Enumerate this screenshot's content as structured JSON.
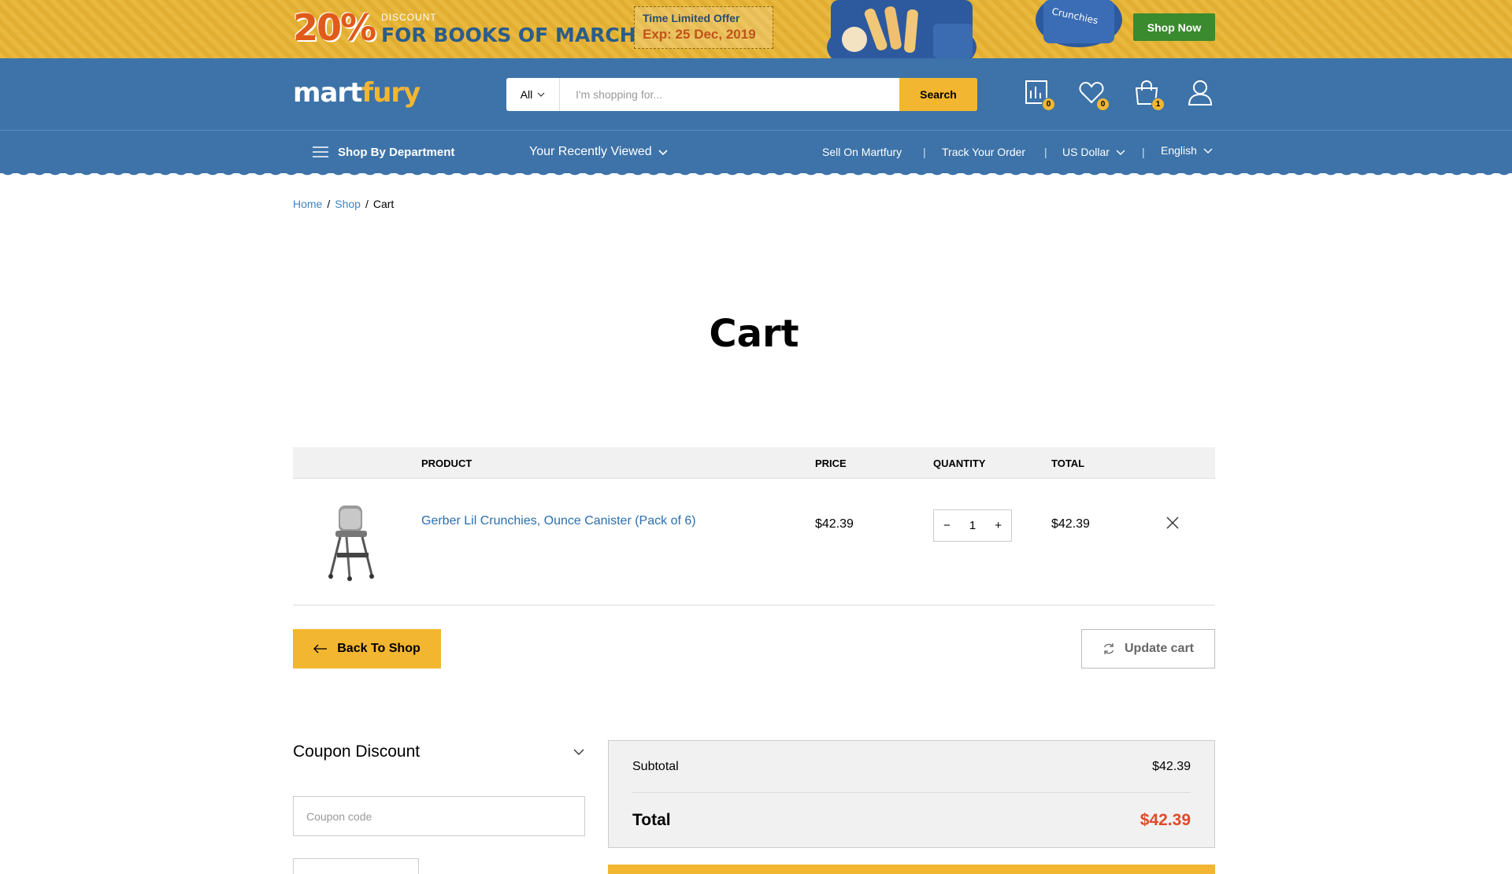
{
  "promo": {
    "percent": "20%",
    "discount_label": "DISCOUNT",
    "headline": "FOR BOOKS OF MARCH",
    "offer_title": "Time Limited Offer",
    "offer_expiry": "Exp: 25 Dec, 2019",
    "shop_now": "Shop Now"
  },
  "header": {
    "logo_part1": "mart",
    "logo_part2": "fury",
    "search": {
      "category": "All",
      "placeholder": "I'm shopping for...",
      "button": "Search"
    },
    "icons": {
      "compare_count": "0",
      "wishlist_count": "0",
      "cart_count": "1"
    }
  },
  "nav": {
    "department": "Shop By Department",
    "recently_viewed": "Your Recently Viewed",
    "sell": "Sell On Martfury",
    "track": "Track Your Order",
    "currency": "US Dollar",
    "language": "English"
  },
  "breadcrumb": {
    "home": "Home",
    "shop": "Shop",
    "current": "Cart"
  },
  "page_title": "Cart",
  "table": {
    "headers": {
      "product": "PRODUCT",
      "price": "PRICE",
      "quantity": "QUANTITY",
      "total": "TOTAL"
    },
    "rows": [
      {
        "name": "Gerber Lil Crunchies, Ounce Canister (Pack of 6)",
        "price": "$42.39",
        "quantity": "1",
        "total": "$42.39"
      }
    ]
  },
  "actions": {
    "back": "Back To Shop",
    "update": "Update cart"
  },
  "coupon": {
    "title": "Coupon Discount",
    "placeholder": "Coupon code"
  },
  "totals": {
    "subtotal_label": "Subtotal",
    "subtotal_value": "$42.39",
    "total_label": "Total",
    "total_value": "$42.39"
  }
}
